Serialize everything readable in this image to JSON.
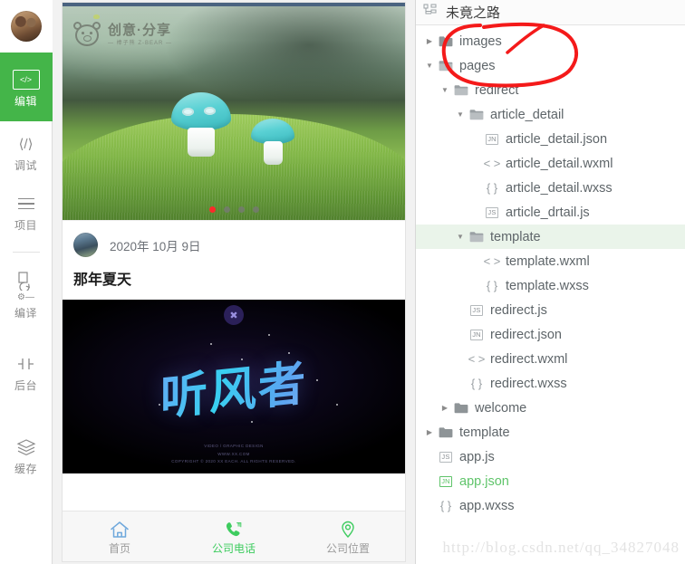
{
  "colors": {
    "accent_green": "#44b549",
    "tab_active_green": "#3ecc5f",
    "tree_selected_bg": "#eaf4ea",
    "modified_file_green": "#5fc46a",
    "annotation_red": "#f41a1a",
    "dot_active_red": "#fb2a2a",
    "phone_topbar": "#4a6380"
  },
  "sidebar": {
    "avatar_name": "user-avatar",
    "items": [
      {
        "label": "编辑",
        "icon": "code-box-icon",
        "active": true
      },
      {
        "label": "调试",
        "icon": "angle-brackets-icon",
        "active": false
      },
      {
        "label": "项目",
        "icon": "hamburger-icon",
        "active": false
      },
      {
        "label": "编译",
        "icon": "compile-refresh-icon",
        "active": false
      },
      {
        "label": "后台",
        "icon": "backend-panel-icon",
        "active": false
      },
      {
        "label": "缓存",
        "icon": "layers-cache-icon",
        "active": false
      }
    ]
  },
  "preview": {
    "banner": {
      "logo_main": "创意·分享",
      "logo_sub": "— 棒子熊 Z-BEAR —",
      "mascot": "bear-mascot-icon",
      "carousel_dots": 4,
      "carousel_active_index": 0
    },
    "article": {
      "avatar_name": "author-avatar",
      "date": "2020年 10月 9日",
      "title": "那年夏天"
    },
    "dark_image": {
      "headline": "听风者",
      "badge_icon": "logo-badge-icon",
      "fineprint_lines": [
        "VIDEO / GRAPHIC DESIGN",
        "WWW.XX.COM",
        "COPYRIGHT © 2020 XX EACH. ALL RIGHTS RESERVED."
      ]
    },
    "tabbar": [
      {
        "label": "首页",
        "icon": "home-icon",
        "selected": false,
        "icon_color": "#6fa8dc"
      },
      {
        "label": "公司电话",
        "icon": "phone-icon",
        "selected": true,
        "icon_color": "#3ecc5f"
      },
      {
        "label": "公司位置",
        "icon": "location-pin-icon",
        "selected": false,
        "icon_color": "#3ecc5f"
      }
    ]
  },
  "tree": {
    "header_icon": "project-tree-icon",
    "header_title": "未竟之路",
    "rows": [
      {
        "label": "images",
        "depth": 0,
        "kind": "folder",
        "state": "collapsed",
        "icon": "folder-closed-icon",
        "selected": false,
        "green": false
      },
      {
        "label": "pages",
        "depth": 0,
        "kind": "folder",
        "state": "expanded",
        "icon": "folder-open-icon",
        "selected": false,
        "green": false
      },
      {
        "label": "redirect",
        "depth": 1,
        "kind": "folder",
        "state": "expanded",
        "icon": "folder-open-icon",
        "selected": false,
        "green": false
      },
      {
        "label": "article_detail",
        "depth": 2,
        "kind": "folder",
        "state": "expanded",
        "icon": "folder-open-icon",
        "selected": false,
        "green": false
      },
      {
        "label": "article_detail.json",
        "depth": 3,
        "kind": "file",
        "state": "none",
        "icon": "json-file-icon",
        "selected": false,
        "green": false,
        "tag": "JN"
      },
      {
        "label": "article_detail.wxml",
        "depth": 3,
        "kind": "file",
        "state": "none",
        "icon": "wxml-file-icon",
        "selected": false,
        "green": false,
        "sym": "< >"
      },
      {
        "label": "article_detail.wxss",
        "depth": 3,
        "kind": "file",
        "state": "none",
        "icon": "wxss-file-icon",
        "selected": false,
        "green": false,
        "sym": "{ }"
      },
      {
        "label": "article_drtail.js",
        "depth": 3,
        "kind": "file",
        "state": "none",
        "icon": "js-file-icon",
        "selected": false,
        "green": false,
        "tag": "JS"
      },
      {
        "label": "template",
        "depth": 2,
        "kind": "folder",
        "state": "expanded",
        "icon": "folder-open-icon",
        "selected": true,
        "green": false
      },
      {
        "label": "template.wxml",
        "depth": 3,
        "kind": "file",
        "state": "none",
        "icon": "wxml-file-icon",
        "selected": false,
        "green": false,
        "sym": "< >"
      },
      {
        "label": "template.wxss",
        "depth": 3,
        "kind": "file",
        "state": "none",
        "icon": "wxss-file-icon",
        "selected": false,
        "green": false,
        "sym": "{ }"
      },
      {
        "label": "redirect.js",
        "depth": 2,
        "kind": "file",
        "state": "none",
        "icon": "js-file-icon",
        "selected": false,
        "green": false,
        "tag": "JS"
      },
      {
        "label": "redirect.json",
        "depth": 2,
        "kind": "file",
        "state": "none",
        "icon": "json-file-icon",
        "selected": false,
        "green": false,
        "tag": "JN"
      },
      {
        "label": "redirect.wxml",
        "depth": 2,
        "kind": "file",
        "state": "none",
        "icon": "wxml-file-icon",
        "selected": false,
        "green": false,
        "sym": "< >"
      },
      {
        "label": "redirect.wxss",
        "depth": 2,
        "kind": "file",
        "state": "none",
        "icon": "wxss-file-icon",
        "selected": false,
        "green": false,
        "sym": "{ }"
      },
      {
        "label": "welcome",
        "depth": 1,
        "kind": "folder",
        "state": "collapsed",
        "icon": "folder-closed-icon",
        "selected": false,
        "green": false
      },
      {
        "label": "template",
        "depth": 0,
        "kind": "folder",
        "state": "collapsed",
        "icon": "folder-closed-icon",
        "selected": false,
        "green": false
      },
      {
        "label": "app.js",
        "depth": 0,
        "kind": "file",
        "state": "none",
        "icon": "js-file-icon",
        "selected": false,
        "green": false,
        "tag": "JS"
      },
      {
        "label": "app.json",
        "depth": 0,
        "kind": "file",
        "state": "none",
        "icon": "json-file-icon",
        "selected": false,
        "green": true,
        "tag": "JN"
      },
      {
        "label": "app.wxss",
        "depth": 0,
        "kind": "file",
        "state": "none",
        "icon": "wxss-file-icon",
        "selected": false,
        "green": false,
        "sym": "{ }"
      }
    ]
  },
  "annotation": {
    "shape": "red-hand-drawn-ellipse",
    "encircles": [
      "images",
      "pages"
    ]
  },
  "watermark": "http://blog.csdn.net/qq_34827048"
}
